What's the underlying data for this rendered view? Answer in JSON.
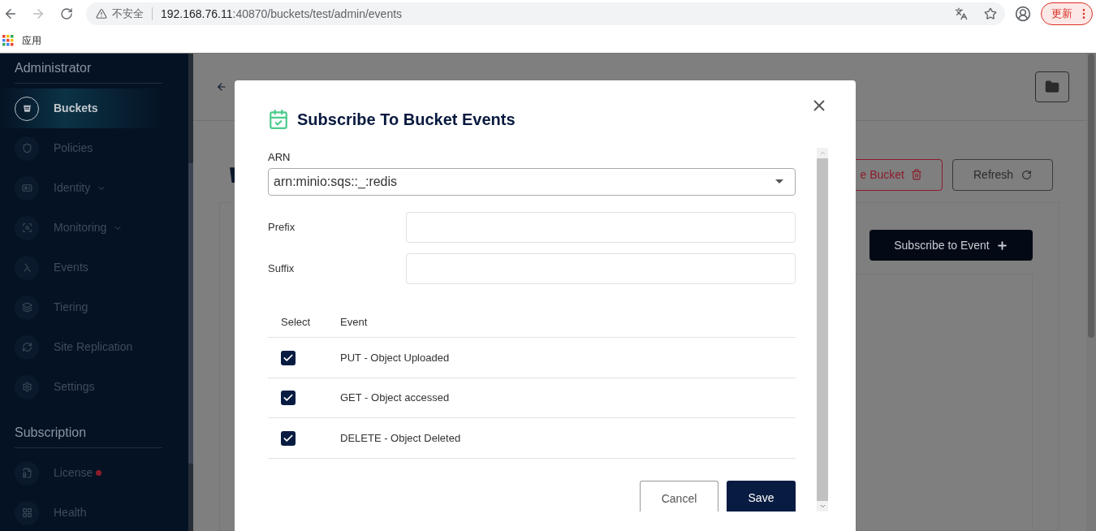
{
  "browser": {
    "security": "不安全",
    "url_host": "192.168.76.11",
    "url_path": ":40870/buckets/test/admin/events",
    "update_button": "更新",
    "bookmarks": [
      {
        "label": "应用"
      }
    ]
  },
  "sidebar": {
    "sections": [
      {
        "title": "Administrator",
        "items": [
          {
            "label": "Buckets",
            "selected": true,
            "has_submenu": false,
            "alert": false
          },
          {
            "label": "Policies",
            "selected": false,
            "has_submenu": false,
            "alert": false
          },
          {
            "label": "Identity",
            "selected": false,
            "has_submenu": true,
            "alert": false
          },
          {
            "label": "Monitoring",
            "selected": false,
            "has_submenu": true,
            "alert": false
          },
          {
            "label": "Events",
            "selected": false,
            "has_submenu": false,
            "alert": false
          },
          {
            "label": "Tiering",
            "selected": false,
            "has_submenu": false,
            "alert": false
          },
          {
            "label": "Site Replication",
            "selected": false,
            "has_submenu": false,
            "alert": false
          },
          {
            "label": "Settings",
            "selected": false,
            "has_submenu": false,
            "alert": false
          }
        ]
      },
      {
        "title": "Subscription",
        "items": [
          {
            "label": "License",
            "selected": false,
            "has_submenu": false,
            "alert": true
          },
          {
            "label": "Health",
            "selected": false,
            "has_submenu": false,
            "alert": false
          }
        ]
      }
    ]
  },
  "page": {
    "delete_button": "e Bucket",
    "refresh_button": "Refresh",
    "subscribe_button": "Subscribe to Event"
  },
  "dialog": {
    "title": "Subscribe To Bucket Events",
    "arn": {
      "label": "ARN",
      "value": "arn:minio:sqs::_:redis"
    },
    "prefix": {
      "label": "Prefix"
    },
    "suffix": {
      "label": "Suffix"
    },
    "table": {
      "columns": [
        "Select",
        "Event"
      ],
      "rows": [
        {
          "event": "PUT - Object Uploaded",
          "checked": true
        },
        {
          "event": "GET - Object accessed",
          "checked": true
        },
        {
          "event": "DELETE - Object Deleted",
          "checked": true
        }
      ]
    },
    "buttons": [
      {
        "label": "Cancel",
        "kind": "secondary"
      },
      {
        "label": "Save",
        "kind": "primary"
      }
    ]
  }
}
